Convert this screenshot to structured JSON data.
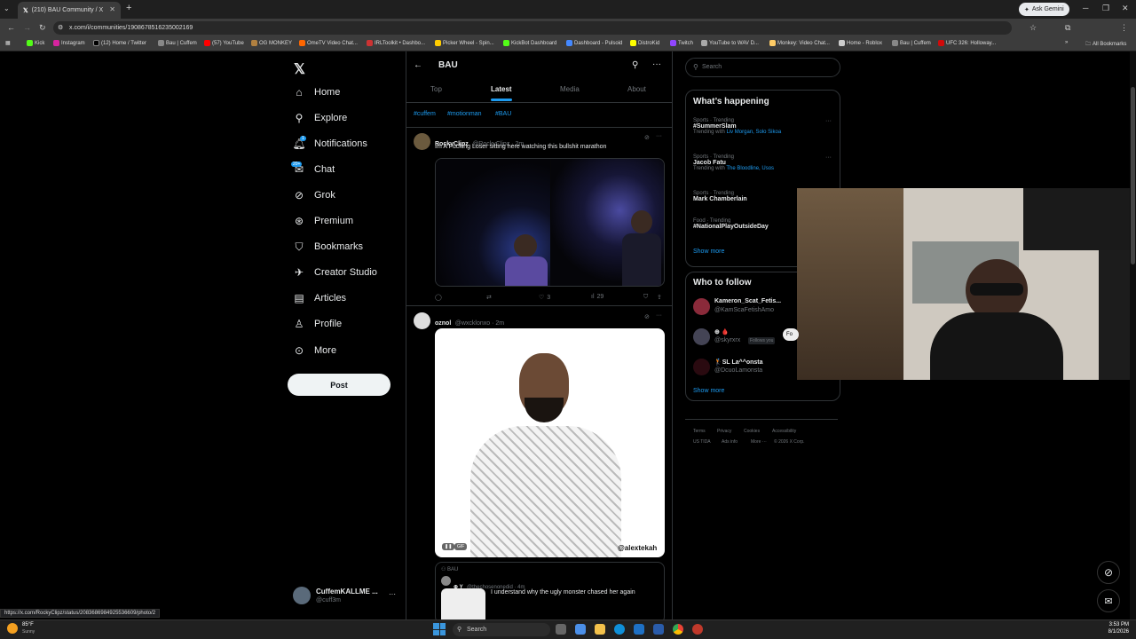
{
  "browser": {
    "tab_title": "(210) BAU Community / X",
    "new_tab_symbol": "+",
    "ask_gemini": "Ask Gemini",
    "url": "x.com/i/communities/1908678516235002169",
    "bookmarks": [
      "Kick",
      "Instagram",
      "(12) Home / Twitter",
      "Bau | Cuffem",
      "(57) YouTube",
      "OG MONKEY",
      "OmeTV Video Chat...",
      "IRLToolkit • Dashbo...",
      "Picker Wheel - Spin...",
      "KickBot Dashboard",
      "Dashboard - Pulsoid",
      "DistroKid",
      "Twitch",
      "YouTube to WAV D...",
      "Monkey: Video Chat...",
      "Home - Roblox",
      "Bau | Cuffem",
      "UFC 326: Holloway..."
    ],
    "all_bookmarks": "All Bookmarks",
    "status_url": "https://x.com/RockyClipz/status/2083686984925536609/photo/2"
  },
  "sidebar": {
    "items": [
      "Home",
      "Explore",
      "Notifications",
      "Chat",
      "Grok",
      "Premium",
      "Bookmarks",
      "Creator Studio",
      "Articles",
      "Profile",
      "More"
    ],
    "notif_badge": "1",
    "chat_badge": "20+",
    "post_label": "Post",
    "account_name": "CuffemKALLME ...",
    "account_handle": "@cuff3m"
  },
  "community": {
    "title": "BAU",
    "tabs": [
      "Top",
      "Latest",
      "Media",
      "About"
    ],
    "active_tab": "Latest",
    "hashtags": [
      "#cuffem",
      "#motionman",
      "#BAU"
    ]
  },
  "tweets": [
    {
      "name": "RockyClipz",
      "handle": "@RockyClipz · 2m",
      "text": "Im A Fucking Loser sitting here watching this bullshit marathon",
      "likes": "3",
      "views": "29"
    },
    {
      "name": "oznol",
      "handle": "@wxcklonxo · 2m",
      "gif_label": "GIF",
      "watermark": "@alextekah",
      "quote": {
        "community": "BAU",
        "author": "⊕ Y",
        "handle": "@thechosenonedid · 4m",
        "text": "I understand why the ugly monster chased her again"
      }
    }
  ],
  "right": {
    "search_placeholder": "Search",
    "happening_title": "What’s happening",
    "trends": [
      {
        "meta": "Sports · Trending",
        "name": "#SummerSlam",
        "with_label": "Trending with",
        "with": "Liv Morgan, Solo Sikoa"
      },
      {
        "meta": "Sports · Trending",
        "name": "Jacob Fatu",
        "with_label": "Trending with",
        "with": "The Bloodline, Usos"
      },
      {
        "meta": "Sports · Trending",
        "name": "Mark Chamberlain",
        "with_label": "",
        "with": ""
      },
      {
        "meta": "Food · Trending",
        "name": "#NationalPlayOutsideDay",
        "with_label": "",
        "with": ""
      }
    ],
    "show_more": "Show more",
    "follow_title": "Who to follow",
    "follow": [
      {
        "name": "Kameron_Scat_Fetis...",
        "handle": "@KamScaFetishAmo"
      },
      {
        "name": "⊕ 🩸",
        "handle": "@skyrxrx",
        "follows_you": "Follows you"
      },
      {
        "name": "🏌SL La^^onsta",
        "handle": "@DcuoLamonsta"
      }
    ],
    "follow_btn": "Fo",
    "footer": [
      "Terms",
      "Privacy",
      "Cookies",
      "Accessibility",
      "Ads info",
      "More ···",
      "© 2026 X Corp.",
      "US TIDA"
    ]
  },
  "taskbar": {
    "weather_temp": "85°F",
    "weather_desc": "Sunny",
    "search": "Search",
    "time": "3:53 PM",
    "date": "8/1/2026"
  },
  "colors": {
    "accent": "#1d9bf0",
    "bg": "#000000",
    "border": "#2f3336"
  }
}
